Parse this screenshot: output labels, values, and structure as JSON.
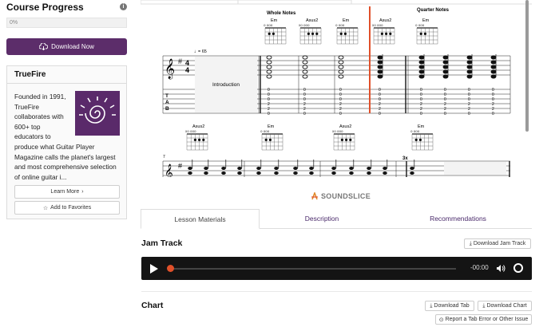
{
  "sidebar": {
    "course_progress_title": "Course Progress",
    "progress_text": "0%",
    "progress_value": 0,
    "download_now_label": "Download Now",
    "brand_color": "#5c2d6a",
    "card": {
      "title": "TrueFire",
      "description_lines": [
        "Founded in 1991,",
        "TrueFire",
        "collaborates with",
        "600+ top",
        "educators to",
        "produce what Guitar Player",
        "Magazine calls the planet's largest",
        "and most comprehensive selection",
        "of online guitar i..."
      ],
      "learn_more_label": "Learn More",
      "add_favorites_label": "Add to Favorites"
    }
  },
  "notation": {
    "section_whole": "Whole Notes",
    "section_quarter": "Quarter Notes",
    "tempo": "= 65",
    "intro_label": "Introduction",
    "row1_chords": [
      "Em",
      "Asus2",
      "Em",
      "Asus2",
      "Em"
    ],
    "row2_chords": [
      "Asus2",
      "Em",
      "Asus2",
      "Em"
    ],
    "measure_number": "7",
    "repeat_label": "3x",
    "playhead_color": "#e0502a"
  },
  "brand": {
    "soundslice_label": "SOUNDSLICE"
  },
  "tabs": [
    {
      "label": "Lesson Materials"
    },
    {
      "label": "Description"
    },
    {
      "label": "Recommendations"
    }
  ],
  "jam_track": {
    "title": "Jam Track",
    "download_label": "Download Jam Track",
    "time": "-00:00",
    "progress": 0
  },
  "chart_section": {
    "title": "Chart",
    "download_tab_label": "Download Tab",
    "download_chart_label": "Download Chart",
    "report_label": "Report a Tab Error or Other Issue"
  }
}
